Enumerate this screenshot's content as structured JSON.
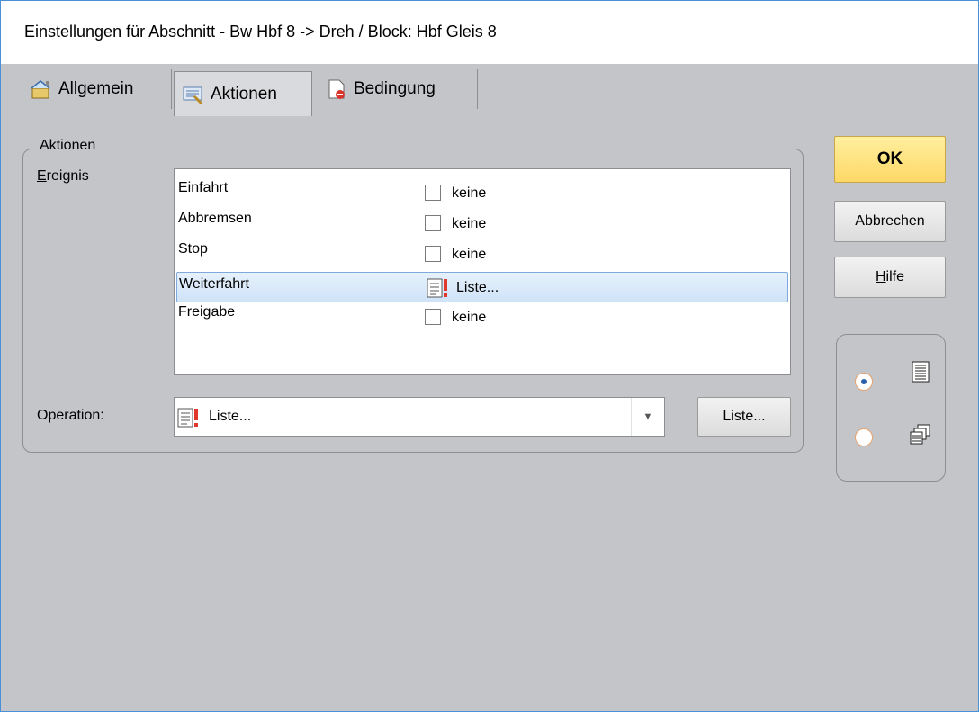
{
  "window": {
    "title": "Einstellungen für Abschnitt - Bw Hbf 8 -> Dreh / Block: Hbf Gleis 8"
  },
  "tabs": [
    {
      "label": "Allgemein",
      "icon": "settings-icon",
      "active": false
    },
    {
      "label": "Aktionen",
      "icon": "actions-icon",
      "active": true
    },
    {
      "label": "Bedingung",
      "icon": "condition-icon",
      "active": false
    }
  ],
  "actions_group": {
    "legend": "Aktionen",
    "event_label": "Ereignis",
    "events": [
      {
        "name": "Einfahrt",
        "value": "keine",
        "checked": false,
        "selected": false
      },
      {
        "name": "Abbremsen",
        "value": "keine",
        "checked": false,
        "selected": false
      },
      {
        "name": "Stop",
        "value": "keine",
        "checked": false,
        "selected": false
      },
      {
        "name": "Weiterfahrt",
        "value": "Liste...",
        "checked": true,
        "selected": true
      },
      {
        "name": "Freigabe",
        "value": "keine",
        "checked": false,
        "selected": false
      }
    ],
    "operation_label": "Operation:",
    "operation_value": "Liste...",
    "list_button": "Liste..."
  },
  "buttons": {
    "ok": "OK",
    "cancel": "Abbrechen",
    "help": "Hilfe"
  },
  "view_options": {
    "selected": "list",
    "options": [
      {
        "id": "list",
        "icon": "list-view-icon"
      },
      {
        "id": "multi",
        "icon": "multi-window-icon"
      }
    ]
  },
  "colors": {
    "ok_button": "#fdd866",
    "selection": "#cfe3f8",
    "background": "#c3c5c9"
  }
}
